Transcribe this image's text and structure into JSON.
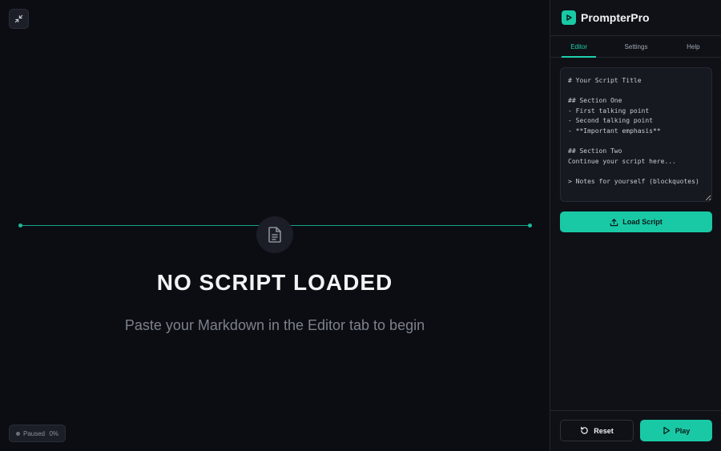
{
  "stage": {
    "empty_title": "NO SCRIPT LOADED",
    "empty_subtitle": "Paste your Markdown in the Editor tab to begin",
    "status": {
      "state": "Paused",
      "progress": "0%"
    },
    "icons": {
      "collapse": "collapse-arrows-icon",
      "document": "document-icon"
    }
  },
  "sidebar": {
    "brand": "PrompterPro",
    "tabs": [
      {
        "label": "Editor",
        "active": true
      },
      {
        "label": "Settings",
        "active": false
      },
      {
        "label": "Help",
        "active": false
      }
    ],
    "editor_text": "# Your Script Title\n\n## Section One\n- First talking point\n- Second talking point\n- **Important emphasis**\n\n## Section Two\nContinue your script here...\n\n> Notes for yourself (blockquotes)\n\n---",
    "load_button": "Load Script",
    "reset_button": "Reset",
    "play_button": "Play"
  },
  "colors": {
    "accent": "#19c9a6",
    "background": "#0b0d12",
    "sidebar": "#0f1117"
  }
}
